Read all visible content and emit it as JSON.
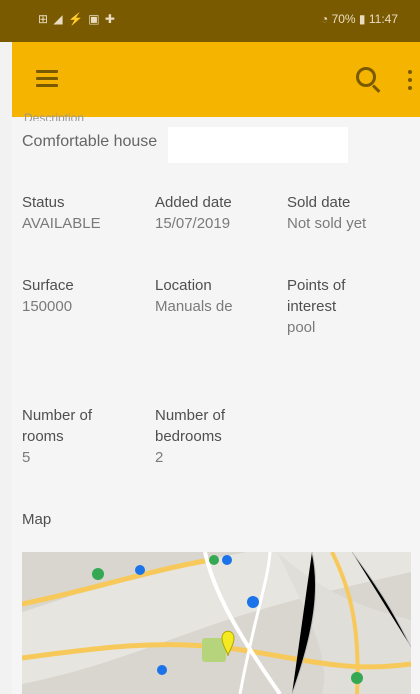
{
  "status_bar": {
    "left_icons": "⊞ ◢ ⚡ ▣ ✚",
    "right_text": "◔ 70% ▮ 11:47"
  },
  "appbar": {
    "menu_icon": "menu-icon",
    "search_icon": "search-icon",
    "more_icon": "more-vert-icon",
    "color": "#f5b400"
  },
  "property": {
    "description_label": "Description",
    "description": "Comfortable house",
    "fields": {
      "status": {
        "label": "Status",
        "value": "AVAILABLE"
      },
      "added_date": {
        "label": "Added date",
        "value": "15/07/2019"
      },
      "sold_date": {
        "label": "Sold date",
        "value": "Not sold yet"
      },
      "surface": {
        "label": "Surface",
        "value": "150000"
      },
      "location": {
        "label": "Location",
        "value": "Manuals de"
      },
      "points_of_interest": {
        "label": "Points of interest",
        "value": "pool"
      },
      "number_of_rooms": {
        "label": "Number of rooms",
        "value": "5"
      },
      "number_of_bedrooms": {
        "label": "Number of bedrooms",
        "value": "2"
      }
    },
    "map_label": "Map"
  }
}
